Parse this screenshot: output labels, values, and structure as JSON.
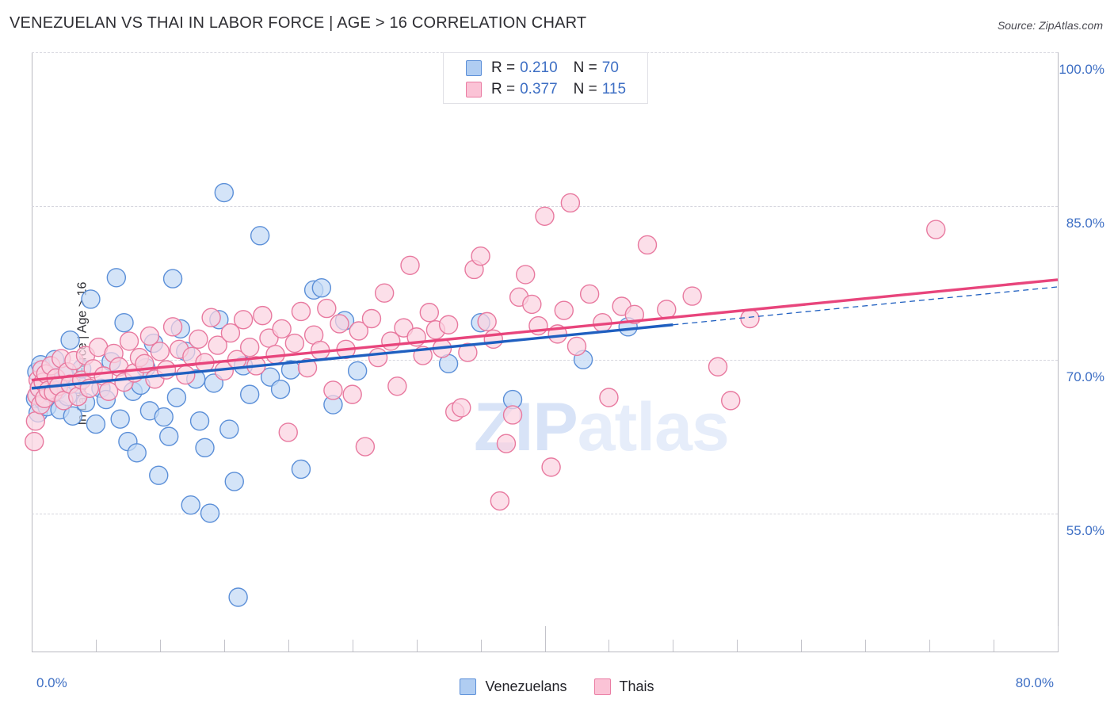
{
  "header": {
    "title": "VENEZUELAN VS THAI IN LABOR FORCE | AGE > 16 CORRELATION CHART",
    "source": "Source: ZipAtlas.com"
  },
  "watermark": {
    "part1": "ZIP",
    "part2": "atlas"
  },
  "legend_box": {
    "rows": [
      {
        "color": "#b0cdf2",
        "r_label": "R =",
        "r_value": "0.210",
        "n_label": "N =",
        "n_value": "70"
      },
      {
        "color": "#fbc3d6",
        "r_label": "R =",
        "r_value": "0.377",
        "n_label": "N =",
        "n_value": "115"
      }
    ]
  },
  "bottom_legend": {
    "items": [
      {
        "label": "Venezuelans",
        "color": "#b0cdf2",
        "border": "#5b8fd8"
      },
      {
        "label": "Thais",
        "color": "#fbc3d6",
        "border": "#ea7ca3"
      }
    ]
  },
  "axes": {
    "y_title": "In Labor Force | Age > 16",
    "y_ticks": [
      "100.0%",
      "85.0%",
      "70.0%",
      "55.0%"
    ],
    "x_min_label": "0.0%",
    "x_max_label": "80.0%"
  },
  "colors": {
    "blue_fill": "#c3daf5",
    "blue_stroke": "#5b8fd8",
    "pink_fill": "#fbd3e0",
    "pink_stroke": "#e8799f",
    "blue_line": "#1f5fc0",
    "pink_line": "#e8457c",
    "axis_text": "#3e6fc4",
    "grid": "#d6d6de"
  },
  "chart_data": {
    "type": "scatter",
    "title": "VENEZUELAN VS THAI IN LABOR FORCE | AGE > 16 CORRELATION CHART",
    "xlabel": "",
    "ylabel": "In Labor Force | Age > 16",
    "xlim": [
      0,
      80
    ],
    "ylim": [
      41.5,
      100
    ],
    "x_tick_values": [
      0,
      5,
      10,
      15,
      20,
      25,
      30,
      35,
      40,
      45,
      50,
      55,
      60,
      65,
      70,
      75,
      80
    ],
    "y_tick_values": [
      55,
      70,
      85,
      100
    ],
    "grid": true,
    "legend_position": "bottom-center",
    "series": [
      {
        "name": "Venezuelans",
        "fill": "#c3daf5",
        "stroke": "#5b8fd8",
        "R": 0.21,
        "N": 70,
        "trend": {
          "x0": 0,
          "y0": 67.2,
          "x1": 50,
          "y1": 73.4,
          "solid_to_x": 50,
          "dashed_to_x": 80,
          "y_at_80": 77.1
        },
        "points": [
          [
            0.3,
            66.2
          ],
          [
            0.4,
            68.8
          ],
          [
            0.5,
            64.8
          ],
          [
            0.6,
            67.3
          ],
          [
            0.7,
            69.5
          ],
          [
            0.9,
            66.0
          ],
          [
            1.0,
            67.8
          ],
          [
            1.2,
            65.4
          ],
          [
            1.4,
            68.2
          ],
          [
            1.5,
            66.7
          ],
          [
            1.8,
            70.0
          ],
          [
            2.0,
            67.0
          ],
          [
            2.2,
            65.1
          ],
          [
            2.5,
            68.5
          ],
          [
            2.8,
            66.4
          ],
          [
            3.0,
            71.9
          ],
          [
            3.2,
            64.5
          ],
          [
            3.6,
            67.6
          ],
          [
            3.9,
            69.1
          ],
          [
            4.2,
            65.8
          ],
          [
            4.6,
            75.9
          ],
          [
            5.0,
            63.7
          ],
          [
            5.4,
            67.2
          ],
          [
            5.8,
            66.1
          ],
          [
            6.2,
            69.8
          ],
          [
            6.6,
            78.0
          ],
          [
            6.9,
            64.2
          ],
          [
            7.2,
            73.6
          ],
          [
            7.5,
            62.0
          ],
          [
            7.9,
            66.9
          ],
          [
            8.2,
            60.9
          ],
          [
            8.5,
            67.5
          ],
          [
            8.9,
            69.2
          ],
          [
            9.2,
            65.0
          ],
          [
            9.5,
            71.6
          ],
          [
            9.9,
            58.7
          ],
          [
            10.3,
            64.4
          ],
          [
            10.7,
            62.5
          ],
          [
            11.0,
            77.9
          ],
          [
            11.3,
            66.3
          ],
          [
            11.6,
            73.0
          ],
          [
            12.0,
            70.8
          ],
          [
            12.4,
            55.8
          ],
          [
            12.8,
            68.1
          ],
          [
            13.1,
            64.0
          ],
          [
            13.5,
            61.4
          ],
          [
            13.9,
            55.0
          ],
          [
            14.2,
            67.7
          ],
          [
            14.6,
            73.9
          ],
          [
            15.0,
            86.3
          ],
          [
            15.4,
            63.2
          ],
          [
            15.8,
            58.1
          ],
          [
            16.1,
            46.8
          ],
          [
            16.5,
            69.4
          ],
          [
            17.0,
            66.6
          ],
          [
            17.8,
            82.1
          ],
          [
            18.6,
            68.3
          ],
          [
            19.4,
            67.1
          ],
          [
            20.2,
            69.0
          ],
          [
            21.0,
            59.3
          ],
          [
            22.0,
            76.8
          ],
          [
            22.6,
            77.0
          ],
          [
            23.5,
            65.6
          ],
          [
            24.4,
            73.8
          ],
          [
            25.4,
            68.9
          ],
          [
            32.5,
            69.6
          ],
          [
            35.0,
            73.6
          ],
          [
            37.5,
            66.1
          ],
          [
            43.0,
            70.0
          ],
          [
            46.5,
            73.2
          ]
        ]
      },
      {
        "name": "Thais",
        "fill": "#fbd3e0",
        "stroke": "#e8799f",
        "R": 0.377,
        "N": 115,
        "trend": {
          "x0": 0,
          "y0": 68.0,
          "x1": 80,
          "y1": 77.8
        },
        "points": [
          [
            0.2,
            62.0
          ],
          [
            0.3,
            64.0
          ],
          [
            0.4,
            66.5
          ],
          [
            0.5,
            68.0
          ],
          [
            0.6,
            67.2
          ],
          [
            0.7,
            65.6
          ],
          [
            0.8,
            69.0
          ],
          [
            0.9,
            67.8
          ],
          [
            1.0,
            66.2
          ],
          [
            1.1,
            68.6
          ],
          [
            1.3,
            67.0
          ],
          [
            1.5,
            69.4
          ],
          [
            1.7,
            66.8
          ],
          [
            1.9,
            68.2
          ],
          [
            2.1,
            67.4
          ],
          [
            2.3,
            70.1
          ],
          [
            2.5,
            66.0
          ],
          [
            2.8,
            68.8
          ],
          [
            3.0,
            67.6
          ],
          [
            3.3,
            69.9
          ],
          [
            3.6,
            66.4
          ],
          [
            3.9,
            68.0
          ],
          [
            4.2,
            70.4
          ],
          [
            4.5,
            67.2
          ],
          [
            4.8,
            69.1
          ],
          [
            5.2,
            71.2
          ],
          [
            5.6,
            68.4
          ],
          [
            6.0,
            66.9
          ],
          [
            6.4,
            70.6
          ],
          [
            6.8,
            69.3
          ],
          [
            7.2,
            67.8
          ],
          [
            7.6,
            71.8
          ],
          [
            8.0,
            68.7
          ],
          [
            8.4,
            70.2
          ],
          [
            8.8,
            69.6
          ],
          [
            9.2,
            72.3
          ],
          [
            9.6,
            68.1
          ],
          [
            10.0,
            70.8
          ],
          [
            10.5,
            69.0
          ],
          [
            11.0,
            73.2
          ],
          [
            11.5,
            71.0
          ],
          [
            12.0,
            68.5
          ],
          [
            12.5,
            70.3
          ],
          [
            13.0,
            72.0
          ],
          [
            13.5,
            69.7
          ],
          [
            14.0,
            74.1
          ],
          [
            14.5,
            71.4
          ],
          [
            15.0,
            68.9
          ],
          [
            15.5,
            72.6
          ],
          [
            16.0,
            70.0
          ],
          [
            16.5,
            73.9
          ],
          [
            17.0,
            71.2
          ],
          [
            17.5,
            69.4
          ],
          [
            18.0,
            74.3
          ],
          [
            18.5,
            72.1
          ],
          [
            19.0,
            70.5
          ],
          [
            19.5,
            73.0
          ],
          [
            20.0,
            62.9
          ],
          [
            20.5,
            71.6
          ],
          [
            21.0,
            74.7
          ],
          [
            21.5,
            69.2
          ],
          [
            22.0,
            72.4
          ],
          [
            22.5,
            70.9
          ],
          [
            23.0,
            75.0
          ],
          [
            23.5,
            67.0
          ],
          [
            24.0,
            73.5
          ],
          [
            24.5,
            71.0
          ],
          [
            25.0,
            66.6
          ],
          [
            25.5,
            72.8
          ],
          [
            26.0,
            61.5
          ],
          [
            26.5,
            74.0
          ],
          [
            27.0,
            70.2
          ],
          [
            27.5,
            76.5
          ],
          [
            28.0,
            71.8
          ],
          [
            28.5,
            67.4
          ],
          [
            29.0,
            73.1
          ],
          [
            29.5,
            79.2
          ],
          [
            30.0,
            72.2
          ],
          [
            30.5,
            70.4
          ],
          [
            31.0,
            74.6
          ],
          [
            31.5,
            72.9
          ],
          [
            32.0,
            71.1
          ],
          [
            32.5,
            73.4
          ],
          [
            33.0,
            64.9
          ],
          [
            33.5,
            65.3
          ],
          [
            34.0,
            70.7
          ],
          [
            34.5,
            78.8
          ],
          [
            35.0,
            80.1
          ],
          [
            35.5,
            73.7
          ],
          [
            36.0,
            72.0
          ],
          [
            36.5,
            56.2
          ],
          [
            37.0,
            61.8
          ],
          [
            37.5,
            64.6
          ],
          [
            38.0,
            76.1
          ],
          [
            38.5,
            78.3
          ],
          [
            39.0,
            75.4
          ],
          [
            39.5,
            73.3
          ],
          [
            40.0,
            84.0
          ],
          [
            40.5,
            59.5
          ],
          [
            41.0,
            72.5
          ],
          [
            41.5,
            74.8
          ],
          [
            42.0,
            85.3
          ],
          [
            42.5,
            71.3
          ],
          [
            43.5,
            76.4
          ],
          [
            44.5,
            73.6
          ],
          [
            45.0,
            66.3
          ],
          [
            46.0,
            75.2
          ],
          [
            47.0,
            74.4
          ],
          [
            48.0,
            81.2
          ],
          [
            49.5,
            74.9
          ],
          [
            51.5,
            76.2
          ],
          [
            53.5,
            69.3
          ],
          [
            54.5,
            66.0
          ],
          [
            56.0,
            74.0
          ],
          [
            70.5,
            82.7
          ]
        ]
      }
    ]
  }
}
